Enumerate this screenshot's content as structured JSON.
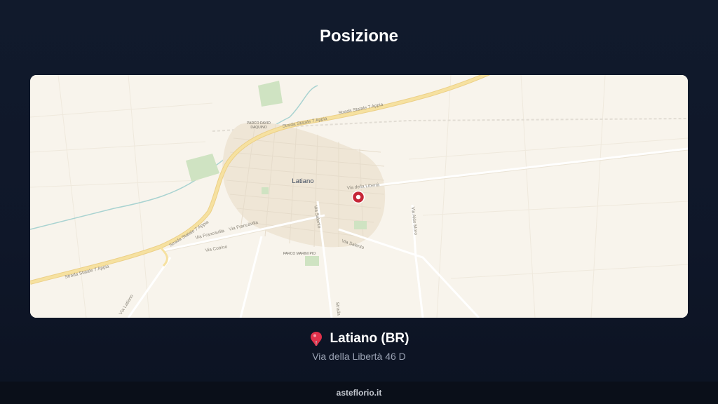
{
  "header": {
    "title": "Posizione"
  },
  "map": {
    "city_label": "Latiano",
    "roads": [
      {
        "name": "Strada Statale 7 Appia"
      },
      {
        "name": "Strada Statale 7 Appia"
      },
      {
        "name": "Strada Statale 7 Appia"
      },
      {
        "name": "Strada Statale 7 Appia"
      },
      {
        "name": "Via della Libertà"
      },
      {
        "name": "Via Francavilla"
      },
      {
        "name": "Via Francavilla"
      },
      {
        "name": "Via Salento"
      },
      {
        "name": "Via Salento"
      },
      {
        "name": "Via Cotrino"
      },
      {
        "name": "Via Aldo Moro"
      },
      {
        "name": "Strada"
      },
      {
        "name": "Via Latiano"
      }
    ],
    "parks": [
      {
        "name": "PARCO DAVID"
      },
      {
        "name": "DAQUINO"
      },
      {
        "name": "PARCO MARINI PIO"
      }
    ],
    "colors": {
      "land": "#f8f4ec",
      "highway": "#f4dc8c",
      "park": "#cfe3c2",
      "river": "#a9d3d1",
      "marker": "#c62637"
    }
  },
  "location": {
    "icon": "map-pin",
    "name": "Latiano (BR)",
    "address": "Via della Libertà 46 D"
  },
  "footer": {
    "site": "asteflorio.it"
  }
}
